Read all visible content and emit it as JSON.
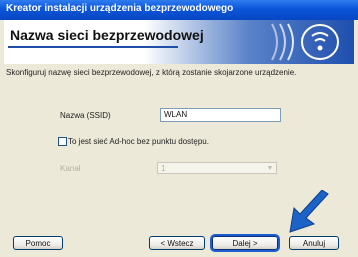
{
  "window": {
    "title": "Kreator instalacji urządzenia bezprzewodowego"
  },
  "header": {
    "title": "Nazwa sieci bezprzewodowej",
    "icon": "wifi-signal-icon"
  },
  "instruction": "Skonfiguruj nazwę sieci bezprzewodowej, z którą zostanie skojarzone urządzenie.",
  "form": {
    "ssid_label": "Nazwa (SSID)",
    "ssid_value": "WLAN",
    "adhoc_label": "To jest sieć Ad-hoc bez punktu dostępu.",
    "adhoc_checked": false,
    "channel_label": "Kanał",
    "channel_value": "1"
  },
  "buttons": {
    "help": "Pomoc",
    "back": "< Wstecz",
    "next": "Dalej >",
    "cancel": "Anuluj"
  },
  "colors": {
    "title_bar": "#0a55d8",
    "header_blue": "#1e4fae",
    "arrow": "#1b63c6"
  }
}
